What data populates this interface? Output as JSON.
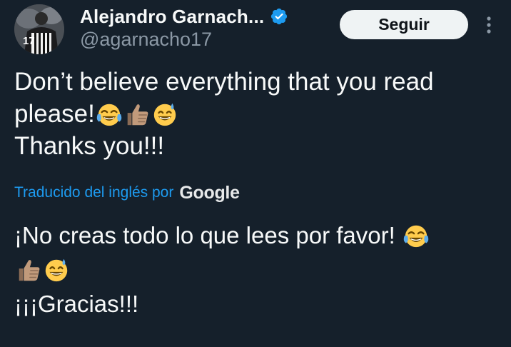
{
  "user": {
    "display_name": "Alejandro Garnach...",
    "handle": "@agarnacho17",
    "verified": true,
    "jersey_number": "17"
  },
  "header": {
    "follow_label": "Seguir"
  },
  "tweet": {
    "original_lines": [
      "Don’t believe everything that you read",
      "please!",
      "Thanks you!!!"
    ],
    "translated_label": "Traducido del inglés por",
    "translation_provider": "Google",
    "translation_lines": [
      "¡No creas todo lo que lees por favor!",
      "¡¡¡Gracias!!!"
    ]
  },
  "icons": {
    "verified": "verified-badge-icon",
    "more": "more-options-icon",
    "emoji": [
      "tears-of-joy-emoji",
      "thumbs-up-emoji",
      "grinning-sweat-emoji"
    ]
  },
  "colors": {
    "background": "#15202b",
    "text": "#f7f9f9",
    "secondary_text": "#8b98a5",
    "link": "#1d9bf0",
    "verified": "#1d9bf0",
    "follow_bg": "#eff3f4"
  }
}
